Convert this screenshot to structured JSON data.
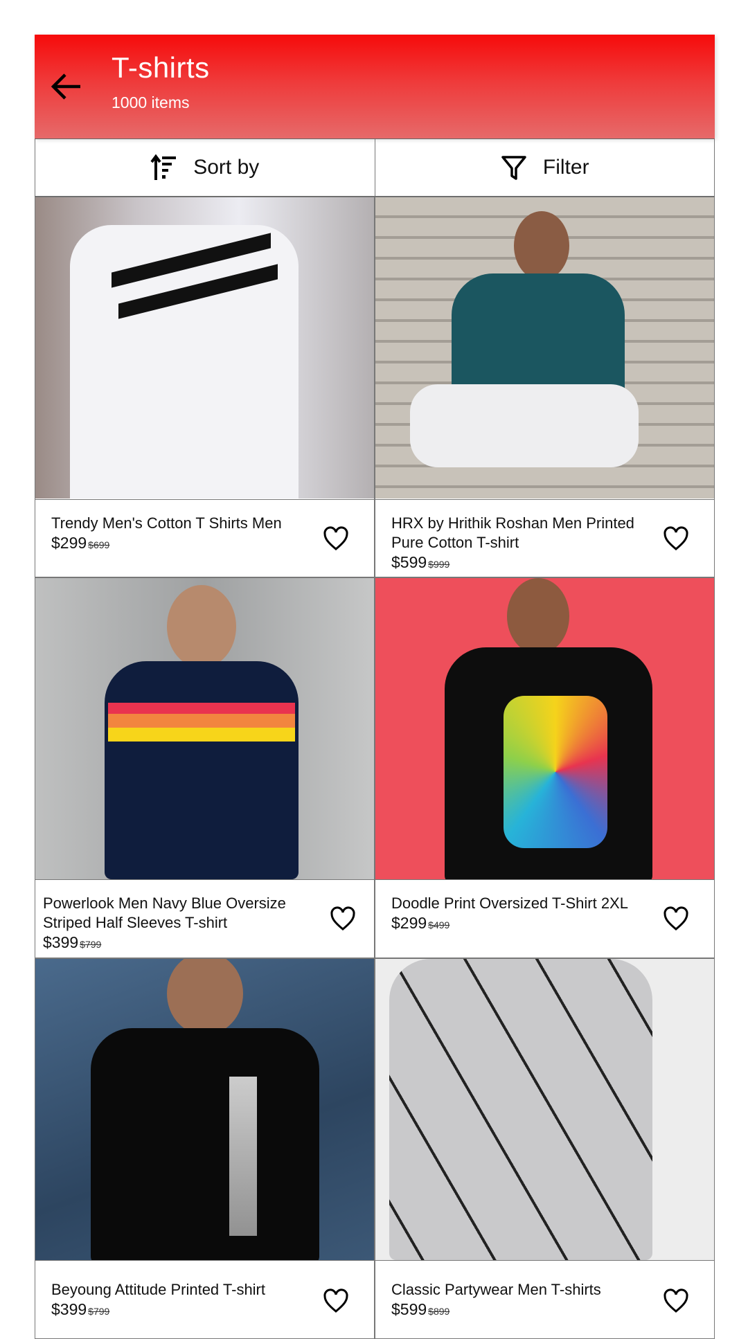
{
  "header": {
    "title": "T-shirts",
    "subtitle": "1000 items",
    "back_icon": "arrow-left-icon",
    "accent_color": "#f60b0b"
  },
  "toolbar": {
    "sort_label": "Sort by",
    "filter_label": "Filter"
  },
  "products": [
    {
      "name": "Trendy Men's Cotton T Shirts Men",
      "price": "$299",
      "old_price": "$699"
    },
    {
      "name": "HRX by Hrithik Roshan Men Printed Pure Cotton T-shirt",
      "price": "$599",
      "old_price": "$999"
    },
    {
      "name": "Powerlook Men Navy Blue Oversize Striped Half Sleeves T-shirt",
      "price": "$399",
      "old_price": "$799"
    },
    {
      "name": "Doodle Print Oversized T-Shirt 2XL",
      "price": "$299",
      "old_price": "$499"
    },
    {
      "name": "Beyoung Attitude Printed T-shirt",
      "price": "$399",
      "old_price": "$799"
    },
    {
      "name": "Classic Partywear Men T-shirts",
      "price": "$599",
      "old_price": "$899"
    }
  ]
}
